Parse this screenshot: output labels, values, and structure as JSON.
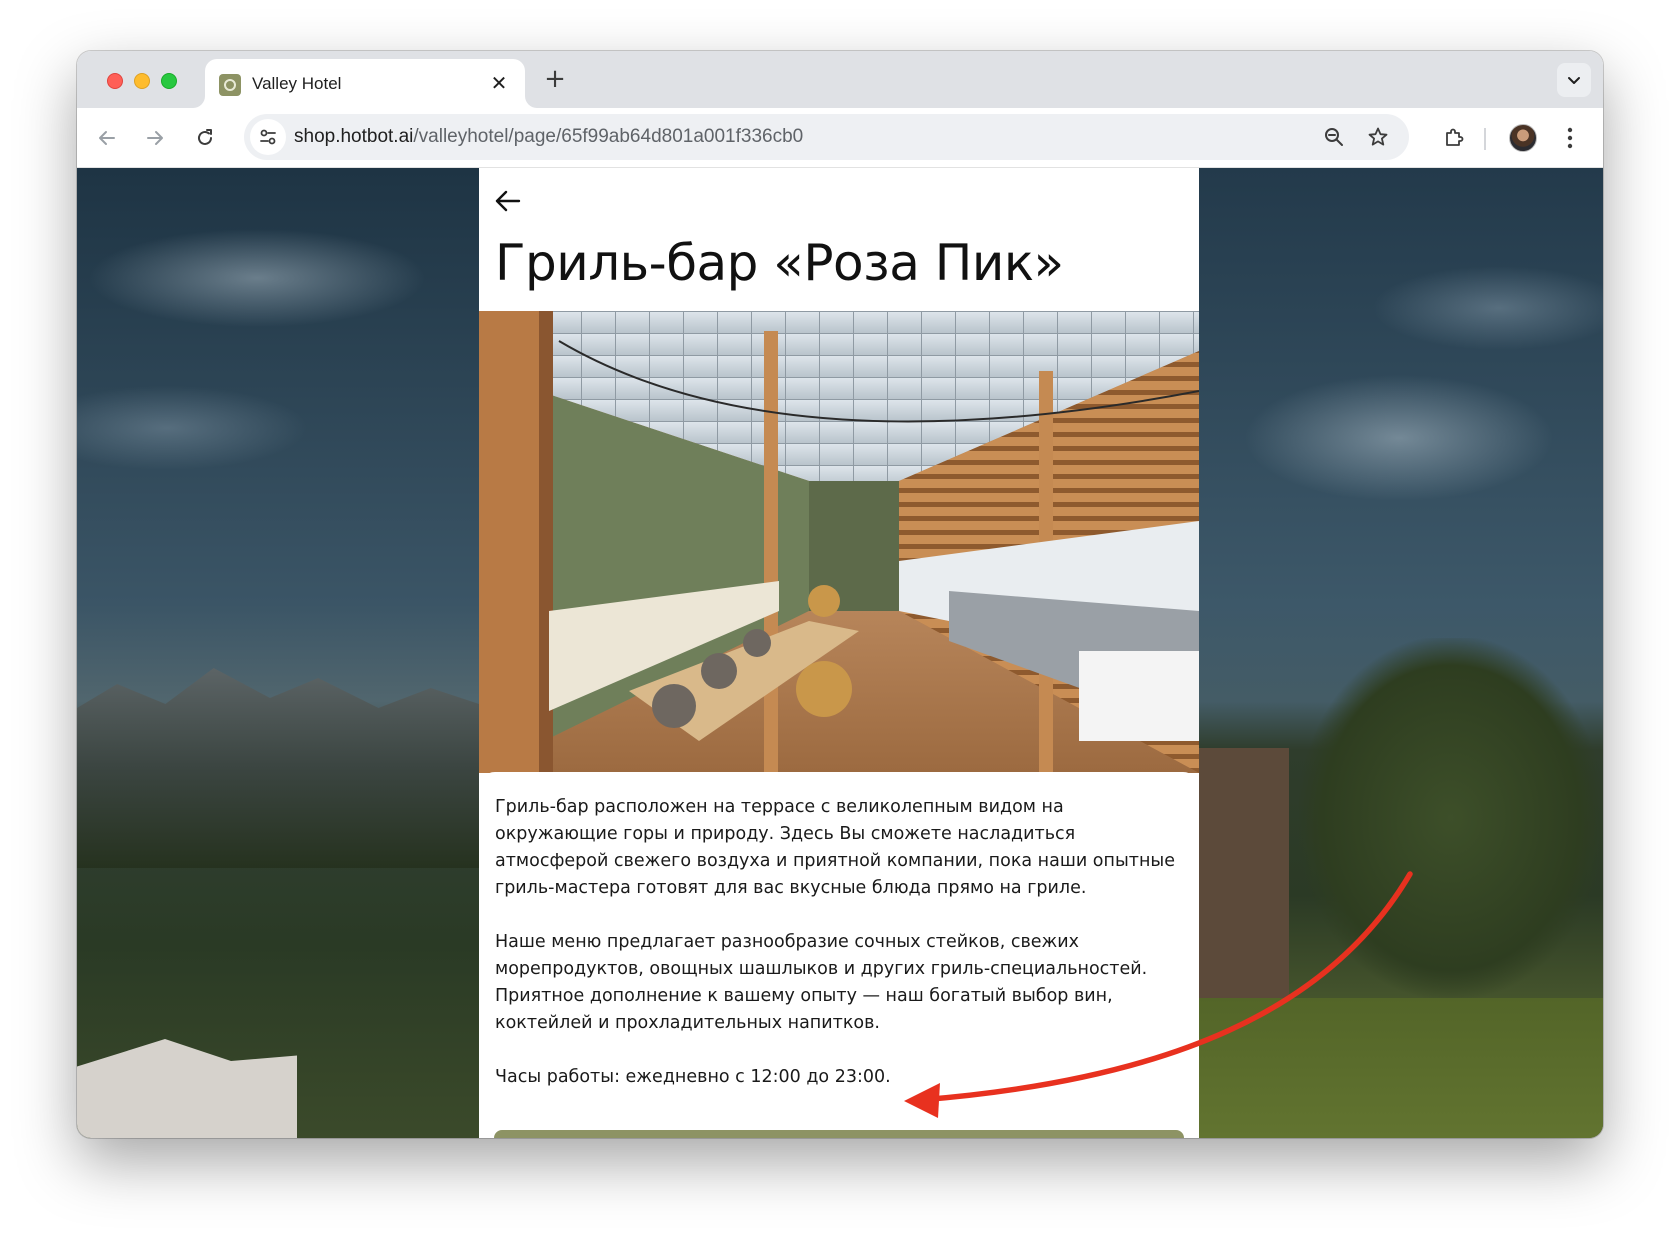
{
  "browser": {
    "tab": {
      "title": "Valley Hotel",
      "favicon": "hotel-logo-icon"
    },
    "new_tab_label": "+",
    "close_tab_label": "✕",
    "url": {
      "host": "shop.hotbot.ai",
      "path": "/valleyhotel/page/65f99ab64d801a001f336cb0"
    }
  },
  "page": {
    "title": "Гриль-бар «Роза Пик»",
    "hero_image": "restaurant-terrace-photo",
    "description": [
      "Гриль-бар расположен на террасе с великолепным видом на окружающие горы и природу. Здесь Вы сможете насладиться атмосферой свежего воздуха и приятной компании, пока наши опытные гриль-мастера готовят для вас вкусные блюда прямо на гриле.",
      "Наше меню предлагает разнообразие сочных стейков, свежих морепродуктов, овощных шашлыков и других гриль-специальностей. Приятное дополнение к вашему опыту — наш богатый выбор вин, коктейлей и прохладительных напитков.",
      "Часы работы: ежедневно с 12:00 до 23:00."
    ]
  },
  "colors": {
    "accent": "#8d9364",
    "annotation_arrow": "#e8311f",
    "background_overlay": "#2b3e4c"
  }
}
